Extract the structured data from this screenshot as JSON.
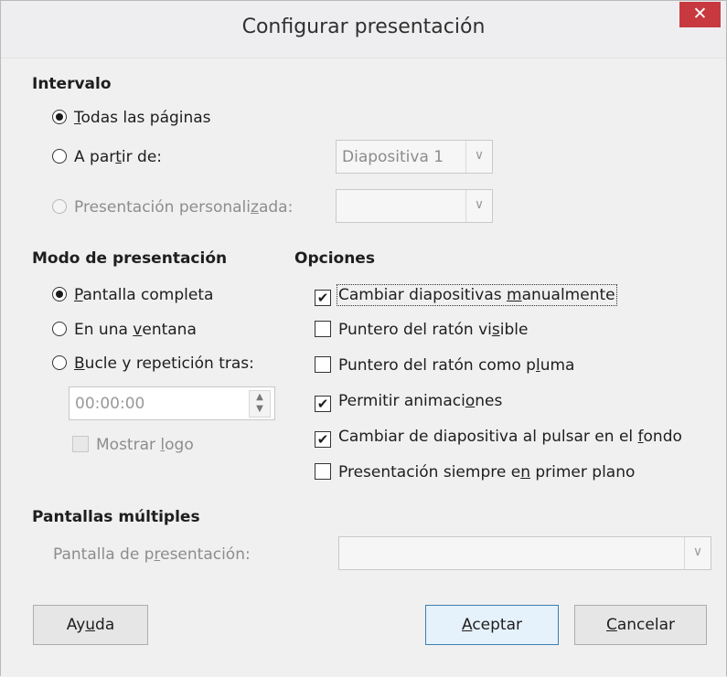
{
  "window": {
    "title": "Configurar presentación",
    "close_label": "✕"
  },
  "intervalo": {
    "heading": "Intervalo",
    "todas": {
      "pre": "",
      "u": "T",
      "post": "odas las páginas",
      "checked": true
    },
    "a_partir": {
      "pre": "A par",
      "u": "t",
      "post": "ir de:",
      "checked": false
    },
    "personalizada": {
      "pre": "Presentación personali",
      "u": "z",
      "post": "ada:",
      "checked": false,
      "disabled": true
    },
    "slide_combo_value": "Diapositiva 1",
    "custom_combo_value": ""
  },
  "modo": {
    "heading": "Modo de presentación",
    "pantalla_completa": {
      "pre": "",
      "u": "P",
      "post": "antalla completa",
      "checked": true
    },
    "ventana": {
      "pre": "En una ",
      "u": "v",
      "post": "entana",
      "checked": false
    },
    "bucle": {
      "pre": "",
      "u": "B",
      "post": "ucle y repetición tras:",
      "checked": false
    },
    "pause_value": "00:00:00",
    "mostrar_logo": {
      "pre": "Mostrar ",
      "u": "l",
      "post": "ogo",
      "checked": false,
      "disabled": true
    }
  },
  "opciones": {
    "heading": "Opciones",
    "items": [
      {
        "pre": "Cambiar diapositivas ",
        "u": "m",
        "post": "anualmente",
        "checked": true
      },
      {
        "pre": "Puntero del ratón vi",
        "u": "s",
        "post": "ible",
        "checked": false
      },
      {
        "pre": "Puntero del ratón como p",
        "u": "l",
        "post": "uma",
        "checked": false
      },
      {
        "pre": "Permitir animaci",
        "u": "o",
        "post": "nes",
        "checked": true
      },
      {
        "pre": "Cambiar de diapositiva al pulsar en el ",
        "u": "f",
        "post": "ondo",
        "checked": true
      },
      {
        "pre": "Presentación siempre e",
        "u": "n",
        "post": " primer plano",
        "checked": false
      }
    ]
  },
  "multiples": {
    "heading": "Pantallas múltiples",
    "label": {
      "pre": "Pantalla de p",
      "u": "r",
      "post": "esentación:"
    },
    "combo_value": ""
  },
  "buttons": {
    "help": {
      "pre": "Ay",
      "u": "u",
      "post": "da"
    },
    "ok": {
      "pre": "",
      "u": "A",
      "post": "ceptar"
    },
    "cancel": {
      "pre": "",
      "u": "C",
      "post": "ancelar"
    }
  },
  "icons": {
    "radio": "radio-button",
    "checkbox": "checkbox",
    "dropdown": "chevron-down-icon",
    "spin": "spin-arrows-icon",
    "close": "close-icon"
  },
  "colors": {
    "close_bg": "#c7393f",
    "default_button_border": "#3c7fb1"
  }
}
